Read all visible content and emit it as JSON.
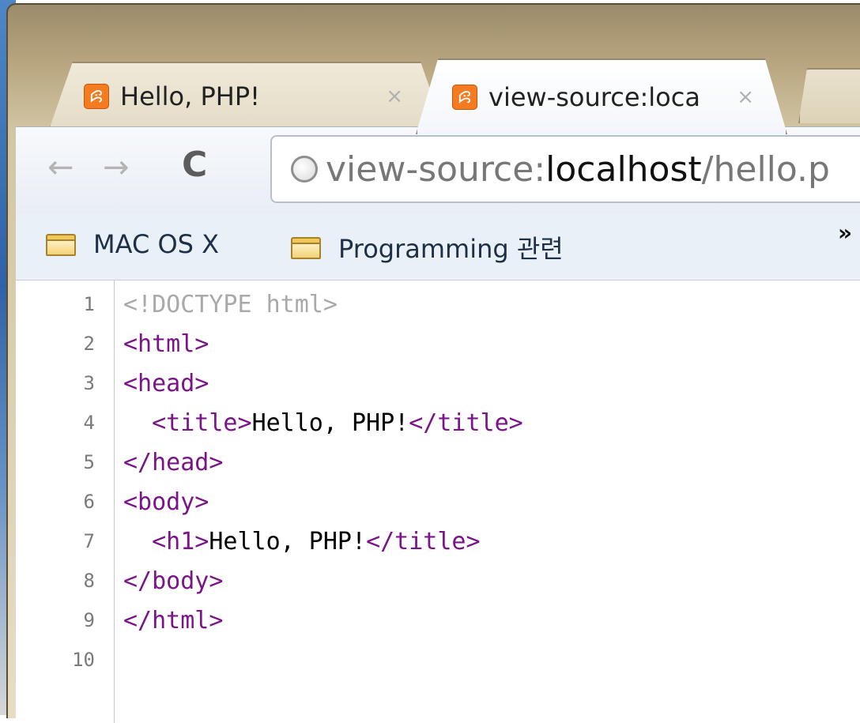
{
  "tabs": [
    {
      "label": "Hello, PHP!",
      "close": "×",
      "active": false
    },
    {
      "label": "view-source:loca",
      "close": "×",
      "active": true
    }
  ],
  "icons": {
    "tab": "xampp-icon",
    "reload": "reload-icon",
    "back": "back-arrow-icon",
    "forward": "forward-arrow-icon",
    "site": "globe-icon",
    "folder": "folder-icon"
  },
  "toolbar": {
    "back": "←",
    "forward": "→",
    "reload": "C",
    "url_prefix": "view-source:",
    "url_host": "localhost",
    "url_path": "/hello.p"
  },
  "bookmarks": {
    "items": [
      {
        "label": "MAC OS X"
      },
      {
        "label": "Programming 관련"
      }
    ],
    "overflow": "»"
  },
  "source": {
    "lines": [
      {
        "n": "1",
        "parts": [
          {
            "t": "<!DOCTYPE html>",
            "c": "doctype"
          }
        ]
      },
      {
        "n": "2",
        "parts": [
          {
            "t": "<html>",
            "c": "tag"
          }
        ]
      },
      {
        "n": "3",
        "parts": [
          {
            "t": "<head>",
            "c": "tag"
          }
        ]
      },
      {
        "n": "4",
        "parts": [
          {
            "t": "  <title>",
            "c": "tag"
          },
          {
            "t": "Hello, PHP!",
            "c": "txt"
          },
          {
            "t": "</title>",
            "c": "tag"
          }
        ]
      },
      {
        "n": "5",
        "parts": [
          {
            "t": "</head>",
            "c": "tag"
          }
        ]
      },
      {
        "n": "6",
        "parts": [
          {
            "t": "<body>",
            "c": "tag"
          }
        ]
      },
      {
        "n": "7",
        "parts": [
          {
            "t": "  <h1>",
            "c": "tag"
          },
          {
            "t": "Hello, PHP!",
            "c": "txt"
          },
          {
            "t": "</title>",
            "c": "tag"
          }
        ]
      },
      {
        "n": "8",
        "parts": [
          {
            "t": "</body>",
            "c": "tag"
          }
        ]
      },
      {
        "n": "9",
        "parts": [
          {
            "t": "</html>",
            "c": "tag"
          }
        ]
      },
      {
        "n": "10",
        "parts": []
      }
    ]
  },
  "colors": {
    "tag": "#7a1488",
    "doctype": "#a9a9a9",
    "text": "#000000",
    "tab_icon": "#f47b20"
  }
}
